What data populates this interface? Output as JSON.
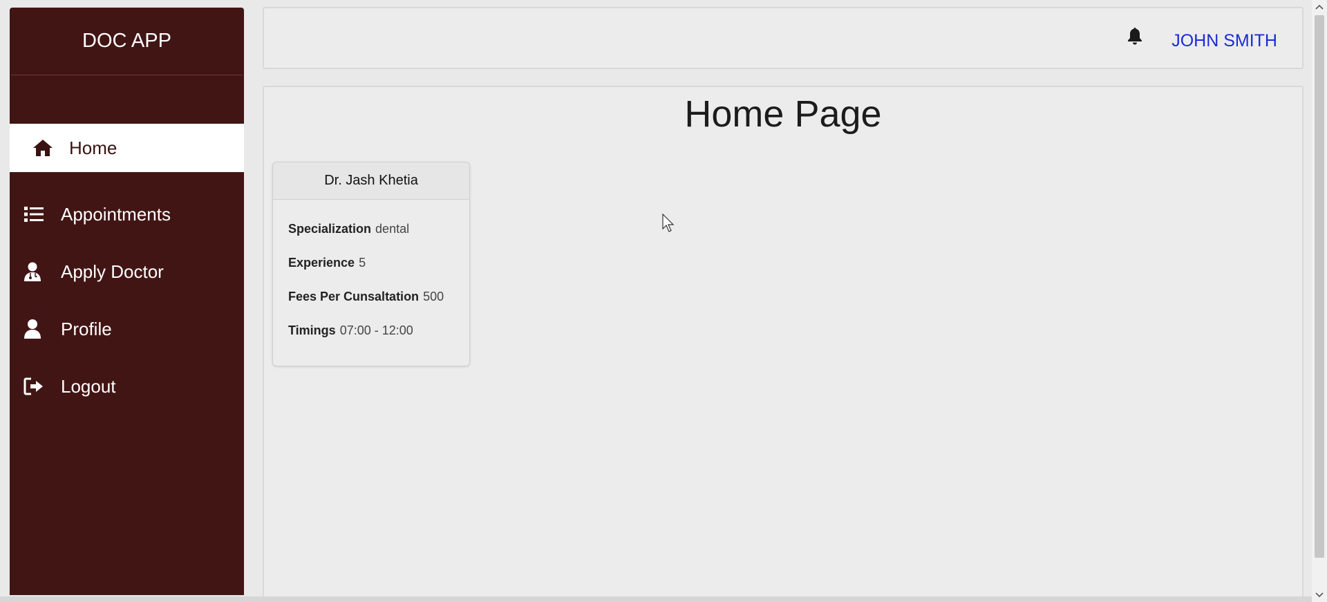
{
  "app": {
    "logo": "DOC APP"
  },
  "sidebar": {
    "items": [
      {
        "label": "Home",
        "icon": "home-icon",
        "active": true
      },
      {
        "label": "Appointments",
        "icon": "list-icon",
        "active": false
      },
      {
        "label": "Apply Doctor",
        "icon": "user-doctor-icon",
        "active": false
      },
      {
        "label": "Profile",
        "icon": "user-icon",
        "active": false
      },
      {
        "label": "Logout",
        "icon": "logout-icon",
        "active": false
      }
    ]
  },
  "header": {
    "notification_icon": "bell-icon",
    "user_name": "JOHN SMITH"
  },
  "main": {
    "title": "Home Page",
    "doctors": [
      {
        "name": "Dr. Jash Khetia",
        "specialization_label": "Specialization",
        "specialization": "dental",
        "experience_label": "Experience",
        "experience": "5",
        "fees_label": "Fees Per Cunsaltation",
        "fees": "500",
        "timings_label": "Timings",
        "timings": "07:00 - 12:00"
      }
    ]
  },
  "colors": {
    "sidebar_bg": "#421515",
    "active_item_bg": "#ffffff",
    "user_link": "#1a2bd6",
    "page_bg": "#ececec"
  }
}
